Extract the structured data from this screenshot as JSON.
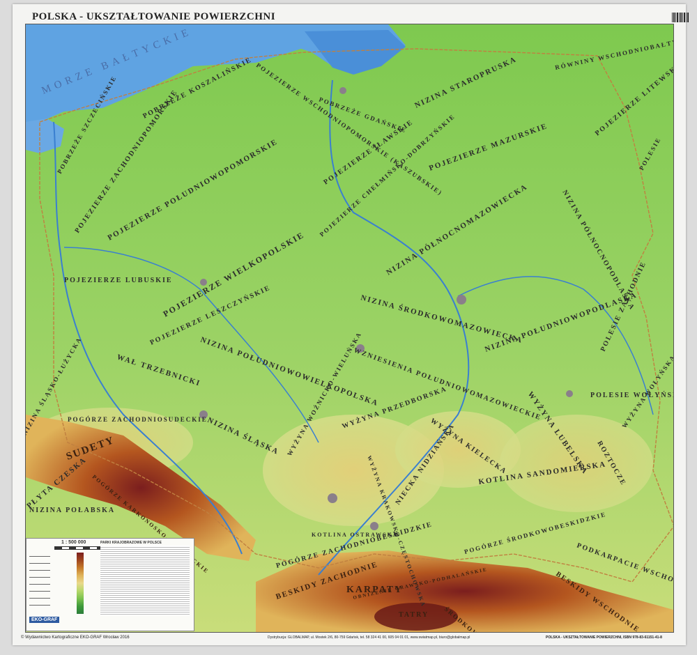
{
  "title_top": "POLSKA - UKSZTAŁTOWANIE POWIERZCHNI",
  "labels": {
    "sea": "MORZE BAŁTYCKIE",
    "pom_zach": "POBRZEŻE KOSZALIŃSKIE",
    "kaszub": "POJEZIERZE WSCHODNIOPOMORSKIE (KASZUBSKIE)",
    "pol_pom": "POJEZIERZE POŁUDNIOWOPOMORSKIE",
    "zach_pom": "POJEZIERZE ZACHODNIOPOMORSKIE",
    "szczec": "POBRZEŻE SZCZECIŃSKIE",
    "gdan": "POBRZEŻE GDAŃSKIE",
    "staro": "NIZINA STAROPRUSKA",
    "rowniny": "RÓWNINY WSCHODNIOBAŁTYCKIE",
    "litew": "POJEZIERZE LITEWSKIE",
    "ilaw": "POJEZIERZE IŁAWSKIE",
    "mazur": "POJEZIERZE MAZURSKIE",
    "chelm": "POJEZIERZE CHEŁMIŃSKO-DOBRZYŃSKIE",
    "polnocnopodl": "NIZINA PÓŁNOCNOPODLASKA",
    "polesie_n": "POLESIE",
    "polnocnomaz": "NIZINA PÓŁNOCNOMAZOWIECKA",
    "wielkop": "POJEZIERZE WIELKOPOLSKIE",
    "lubusk": "POJEZIERZE LUBUSKIE",
    "leszcz": "POJEZIERZE LESZCZYŃSKIE",
    "srodkmaz": "NIZINA ŚRODKOWOMAZOWIECKA",
    "poludnpodl": "NIZINA POŁUDNIOWOPODLASKA",
    "poludnwielk": "NIZINA POŁUDNIOWOWIELKOPOLSKA",
    "wzn_pol": "WZNIESIENIA POŁUDNIOWOMAZOWIECKIE",
    "polesie_zach": "POLESIE ZACHODNIE",
    "polesie_wol": "POLESIE WOŁYŃSKIE",
    "walny": "WAŁ TRZEBNICKI",
    "slask_luz": "NIZINA ŚLĄSKO-ŁUŻYCKA",
    "slask": "NIZINA ŚLĄSKA",
    "pogorze_zach": "POGÓRZE ZACHODNIOSUDECKIE",
    "wozn": "WYŻYNA WOŹNICKO-WIELUŃSKA",
    "przedb": "WYŻYNA PRZEDBORSKA",
    "kielecka": "WYŻYNA KIELECKA",
    "lubelska": "WYŻYNA LUBELSKA",
    "roztocze": "ROZTOCZE",
    "wolynska": "WYŻYNA WOŁYŃSKA",
    "krak_czest": "WYŻYNA KRAKOWSKO-CZĘSTOCHOWSKA",
    "niecka": "NIECKA NIDZIAŃSKA",
    "sandom": "KOTLINA SANDOMIERSKA",
    "sudety": "SUDETY",
    "karkon": "POGÓRZE KARKONOSKO-JESIENICKIE",
    "plyta": "PŁYTA CZESKA",
    "polabska": "NIZINA POŁABSKA",
    "ostrawska": "KOTLINA OSTRAWSKA",
    "pog_zachbesk": "POGÓRZE ZACHODNIOBESKIDZKIE",
    "pog_srodbesk": "POGÓRZE ŚRODKOWOBESKIDZKIE",
    "podkarp": "PODKARPACIE WSCHODNIE",
    "besk_zach": "BESKIDY ZACHODNIE",
    "besk_wsch": "BESKIDY WSCHODNIE",
    "karpaty": "KARPATY",
    "tatry": "TATRY",
    "obn_podh": "OBNIŻENIE ORAWSKO-PODHALAŃSKIE",
    "srodkowe": "ŚRODKOWE"
  },
  "legend": {
    "scale": "1 : 500 000",
    "parks_title": "PARKI KRAJOBRAZOWE W POLSCE",
    "publisher_logo": "EKO-GRAF"
  },
  "footer": {
    "left": "© Wydawnictwo Kartograficzne EKO-GRAF Wrocław 2016",
    "center": "Dystrybucja: GLOBALMAP, ul. Mostek 2/6, 80-759 Gdańsk, tel. 58 324 41 00, 605 04 01 01, www.swiatmap.pl, biuro@globalmap.pl",
    "right": "POLSKA - UKSZTAŁTOWANIE POWIERZCHNI, ISBN 978-83-61151-41-8"
  },
  "colors": {
    "sea": "#5aa0e0",
    "lowland": "#7cc24f",
    "upland": "#e9d98a",
    "mountain": "#a0461e"
  }
}
